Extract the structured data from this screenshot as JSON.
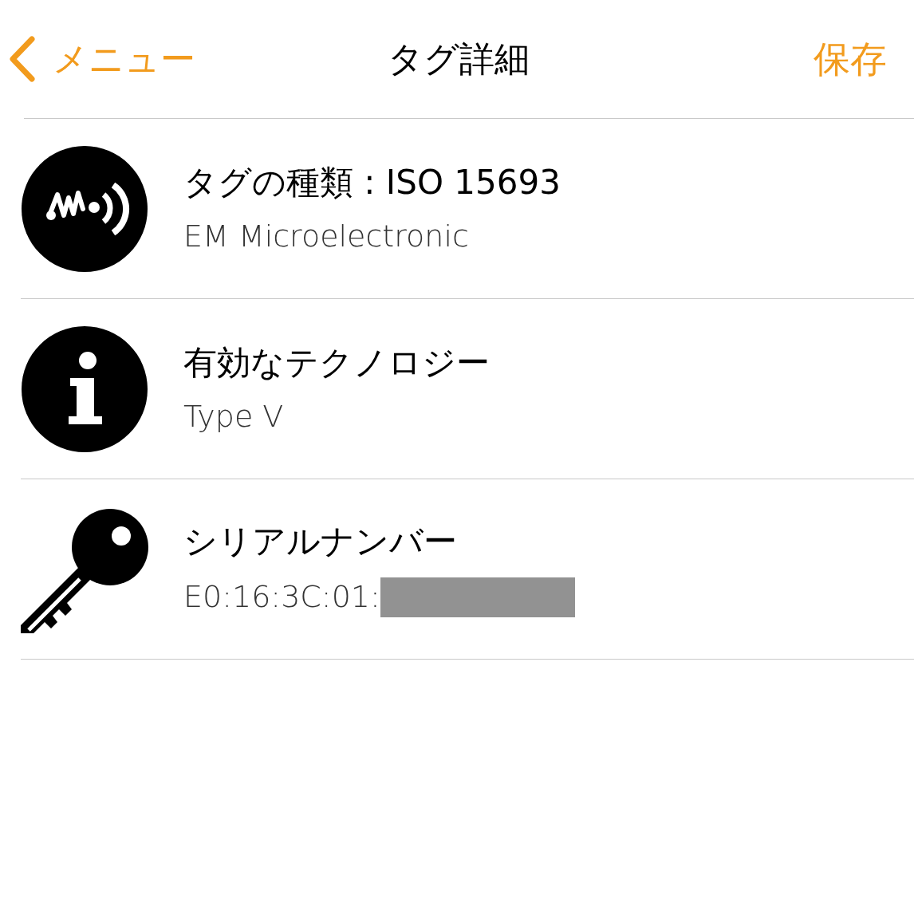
{
  "nav": {
    "back_label": "メニュー",
    "title": "タグ詳細",
    "action": "保存"
  },
  "rows": [
    {
      "kind": "nfc",
      "title": "タグの種類 : ISO 15693",
      "subtitle": "EM Microelectronic",
      "redacted": false
    },
    {
      "kind": "info",
      "title": "有効なテクノロジー",
      "subtitle": "Type V",
      "redacted": false
    },
    {
      "kind": "key",
      "title": "シリアルナンバー",
      "subtitle": "E0:16:3C:01:",
      "redacted": true
    }
  ]
}
